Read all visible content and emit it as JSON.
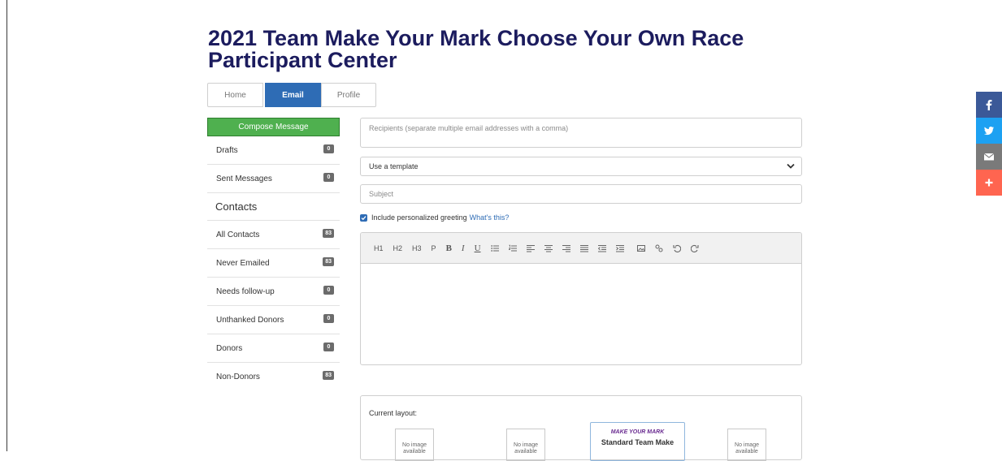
{
  "page": {
    "title": "2021 Team Make Your Mark Choose Your Own Race Participant Center"
  },
  "tabs": [
    {
      "label": "Home",
      "active": false
    },
    {
      "label": "Email",
      "active": true
    },
    {
      "label": "Profile",
      "active": false
    }
  ],
  "sidebar": {
    "compose_label": "Compose Message",
    "folders": [
      {
        "label": "Drafts",
        "count": "0"
      },
      {
        "label": "Sent Messages",
        "count": "0"
      }
    ],
    "contacts_heading": "Contacts",
    "contacts": [
      {
        "label": "All Contacts",
        "count": "83"
      },
      {
        "label": "Never Emailed",
        "count": "83"
      },
      {
        "label": "Needs follow-up",
        "count": "0"
      },
      {
        "label": "Unthanked Donors",
        "count": "0"
      },
      {
        "label": "Donors",
        "count": "0"
      },
      {
        "label": "Non-Donors",
        "count": "83"
      }
    ]
  },
  "compose": {
    "recipients_placeholder": "Recipients (separate multiple email addresses with a comma)",
    "template_selected": "Use a template",
    "subject_placeholder": "Subject",
    "greeting_label": "Include personalized greeting",
    "greeting_link": "What's this?",
    "greeting_checked": true
  },
  "toolbar": {
    "h1": "H1",
    "h2": "H2",
    "h3": "H3",
    "p": "P",
    "bold": "B",
    "italic": "I",
    "underline": "U"
  },
  "layout": {
    "label": "Current layout:",
    "no_image": "No image",
    "no_image_2": "available",
    "standard_logo": "MAKE YOUR MARK",
    "standard_title": "Standard Team Make"
  },
  "colors": {
    "accent": "#2e6cb5",
    "compose": "#4fb04f",
    "title": "#1c1c5e",
    "facebook": "#3b5998",
    "twitter": "#1da1f2",
    "email": "#7a7a7a",
    "share": "#ff6550"
  }
}
